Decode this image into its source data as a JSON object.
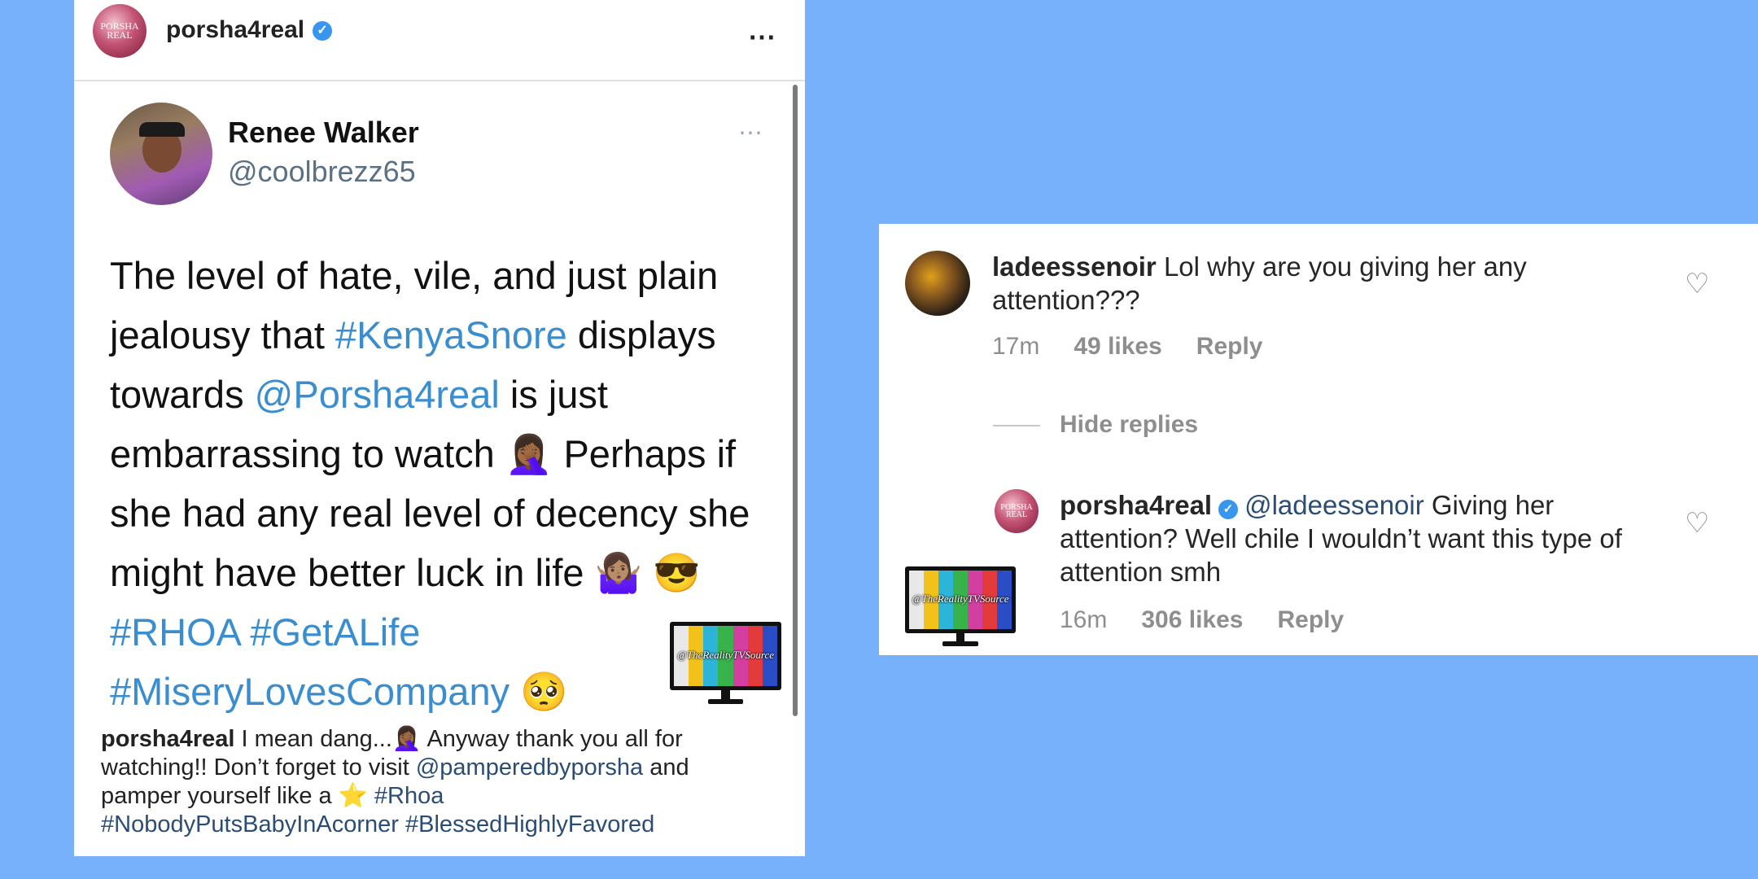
{
  "post": {
    "username": "porsha4real",
    "avatar_monogram": "PORSHA REAL",
    "more_icon": "⋯"
  },
  "tweet": {
    "name": "Renee Walker",
    "handle": "@coolbrezz65",
    "more_icon": "⋯",
    "text": {
      "t1": "The level of hate, vile, and just plain jealousy that ",
      "tag_kenya": "#KenyaSnore",
      "t2": " displays towards ",
      "mention": "@Porsha4real",
      "t3": " is just embarrassing to watch 🤦🏾‍♀️ Perhaps if she had any real level of decency she might have better luck in life 🤷🏽‍♀️ 😎",
      "tag_rhoa": "#RHOA",
      "tag_getalife": "#GetALife",
      "tag_misery": "#MiseryLovesCompany",
      "t4": " 🥺"
    }
  },
  "caption": {
    "username": "porsha4real",
    "t1": " I mean dang...🤦🏾‍♀️ Anyway thank you all for watching!! Don’t forget to visit ",
    "mention": "@pamperedbyporsha",
    "t2": " and pamper yourself like a ⭐ ",
    "tag_rhoa": "#Rhoa",
    "tag_nobody": "#NobodyPutsBabyInAcorner",
    "tag_blessed": "#BlessedHighlyFavored"
  },
  "watermark": {
    "text": "@TheRealityTVSource"
  },
  "comment": {
    "username": "ladeessenoir",
    "text": " Lol why are you giving her any attention???",
    "time": "17m",
    "likes": "49 likes",
    "reply": "Reply",
    "heart_icon": "♡"
  },
  "hide_replies": "Hide replies",
  "reply": {
    "username": "porsha4real",
    "avatar_monogram": "PORSHA REAL",
    "mention": "@ladeessenoir",
    "text": " Giving her attention? Well chile I wouldn’t want this type of attention smh",
    "time": "16m",
    "likes": "306 likes",
    "reply": "Reply",
    "heart_icon": "♡"
  },
  "colors": {
    "background": "#77b1fb",
    "hashtag_blue": "#3a8ed0",
    "caption_link": "#2b4d75",
    "verified": "#3896ef",
    "tv_bars": [
      "#e8e8e8",
      "#f2c21b",
      "#2cb5d8",
      "#38b24a",
      "#d23fa0",
      "#e33b3b",
      "#2a4cc4"
    ]
  }
}
